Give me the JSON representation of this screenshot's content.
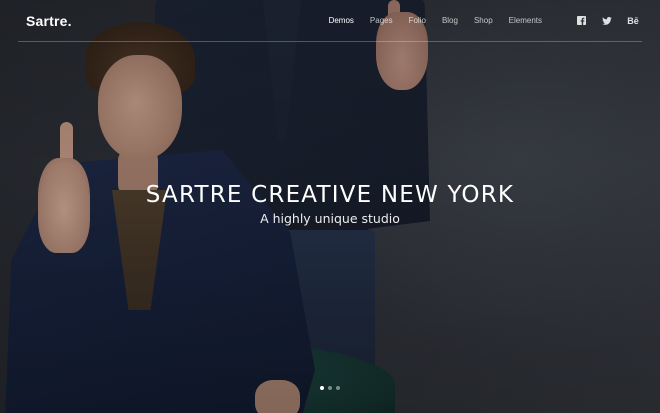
{
  "header": {
    "logo": "Sartre.",
    "nav": [
      {
        "label": "Demos",
        "active": true
      },
      {
        "label": "Pages",
        "active": false
      },
      {
        "label": "Folio",
        "active": false
      },
      {
        "label": "Blog",
        "active": false
      },
      {
        "label": "Shop",
        "active": false
      },
      {
        "label": "Elements",
        "active": false
      }
    ],
    "social": [
      {
        "icon": "facebook-icon",
        "glyph": "f"
      },
      {
        "icon": "twitter-icon",
        "glyph": "🐦"
      },
      {
        "icon": "behance-icon",
        "glyph": "Bē"
      }
    ]
  },
  "hero": {
    "title": "SARTRE CREATIVE NEW YORK",
    "subtitle": "A highly unique studio"
  },
  "slider": {
    "slide_count": 3,
    "active_index": 0
  },
  "colors": {
    "background": "#2a2d33",
    "text": "#ffffff"
  }
}
